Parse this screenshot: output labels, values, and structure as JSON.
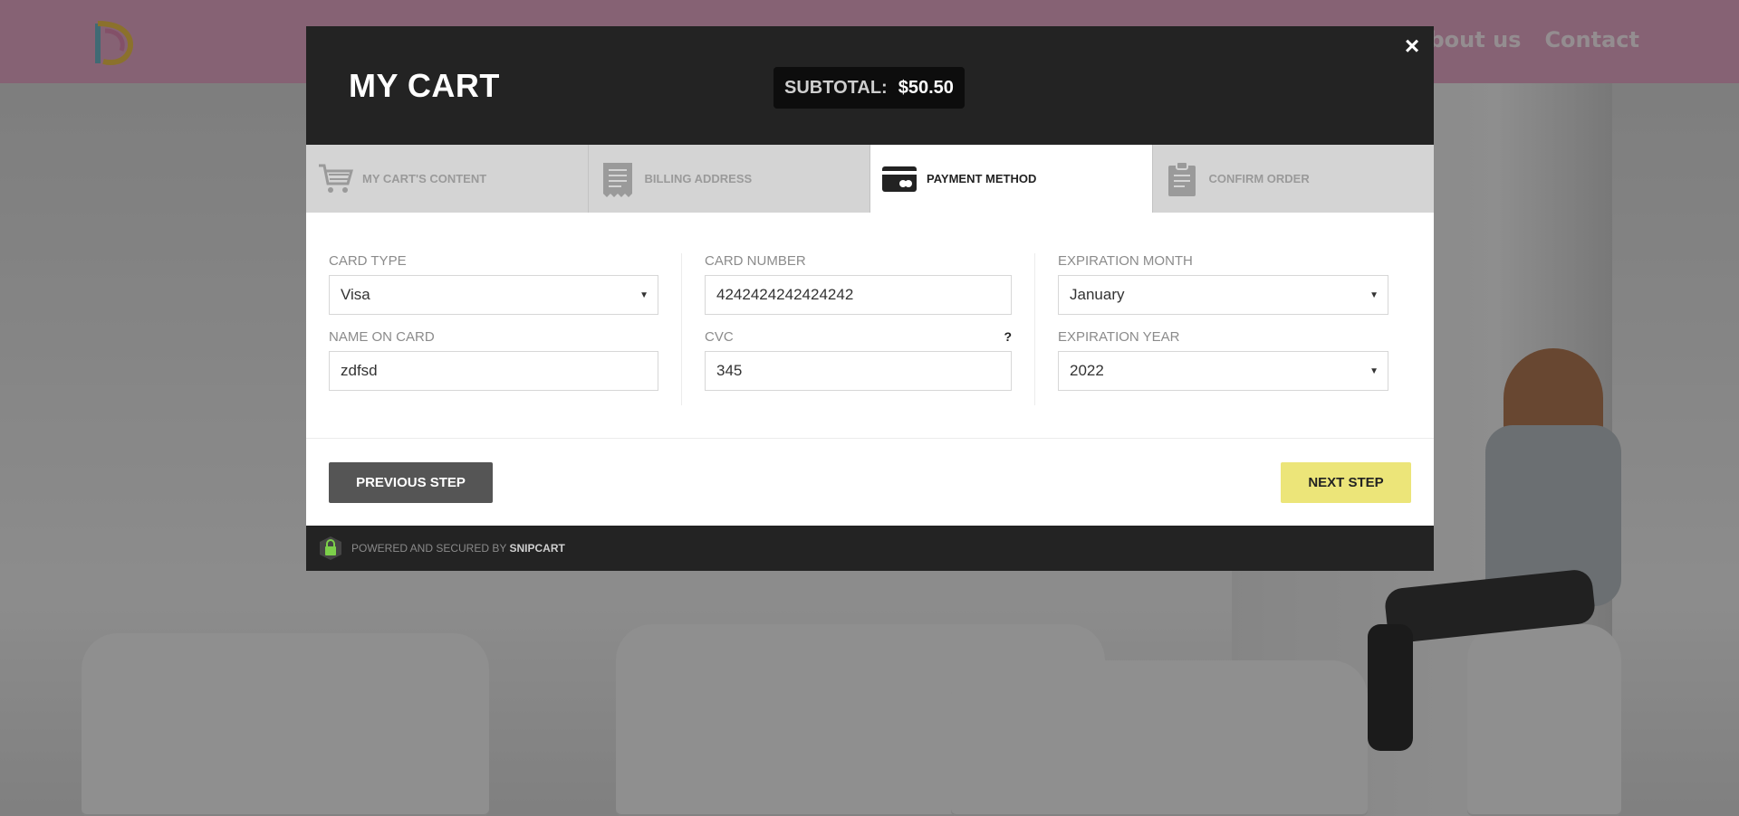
{
  "site": {
    "nav": [
      {
        "label": "About us"
      },
      {
        "label": "Contact"
      }
    ]
  },
  "modal": {
    "title": "MY CART",
    "subtotal_label": "SUBTOTAL:",
    "subtotal_value": "$50.50",
    "close_label": "×",
    "steps": [
      {
        "label": "MY CART'S CONTENT",
        "icon": "cart-icon",
        "active": false
      },
      {
        "label": "BILLING ADDRESS",
        "icon": "receipt-icon",
        "active": false
      },
      {
        "label": "PAYMENT METHOD",
        "icon": "credit-card-icon",
        "active": true
      },
      {
        "label": "CONFIRM ORDER",
        "icon": "clipboard-icon",
        "active": false
      }
    ],
    "form": {
      "card_type": {
        "label": "CARD TYPE",
        "value": "Visa"
      },
      "name_on_card": {
        "label": "NAME ON CARD",
        "value": "zdfsd"
      },
      "card_number": {
        "label": "CARD NUMBER",
        "value": "4242424242424242"
      },
      "cvc": {
        "label": "CVC",
        "value": "345",
        "help": "?"
      },
      "expiration_month": {
        "label": "EXPIRATION MONTH",
        "value": "January"
      },
      "expiration_year": {
        "label": "EXPIRATION YEAR",
        "value": "2022"
      }
    },
    "previous_label": "PREVIOUS STEP",
    "next_label": "NEXT STEP",
    "footer": {
      "powered_text": "POWERED AND SECURED BY",
      "brand": "SNIPCART"
    }
  },
  "colors": {
    "header_bg": "#232323",
    "next_button": "#ece579",
    "previous_button": "#555555",
    "site_header": "#e7a9c9"
  }
}
